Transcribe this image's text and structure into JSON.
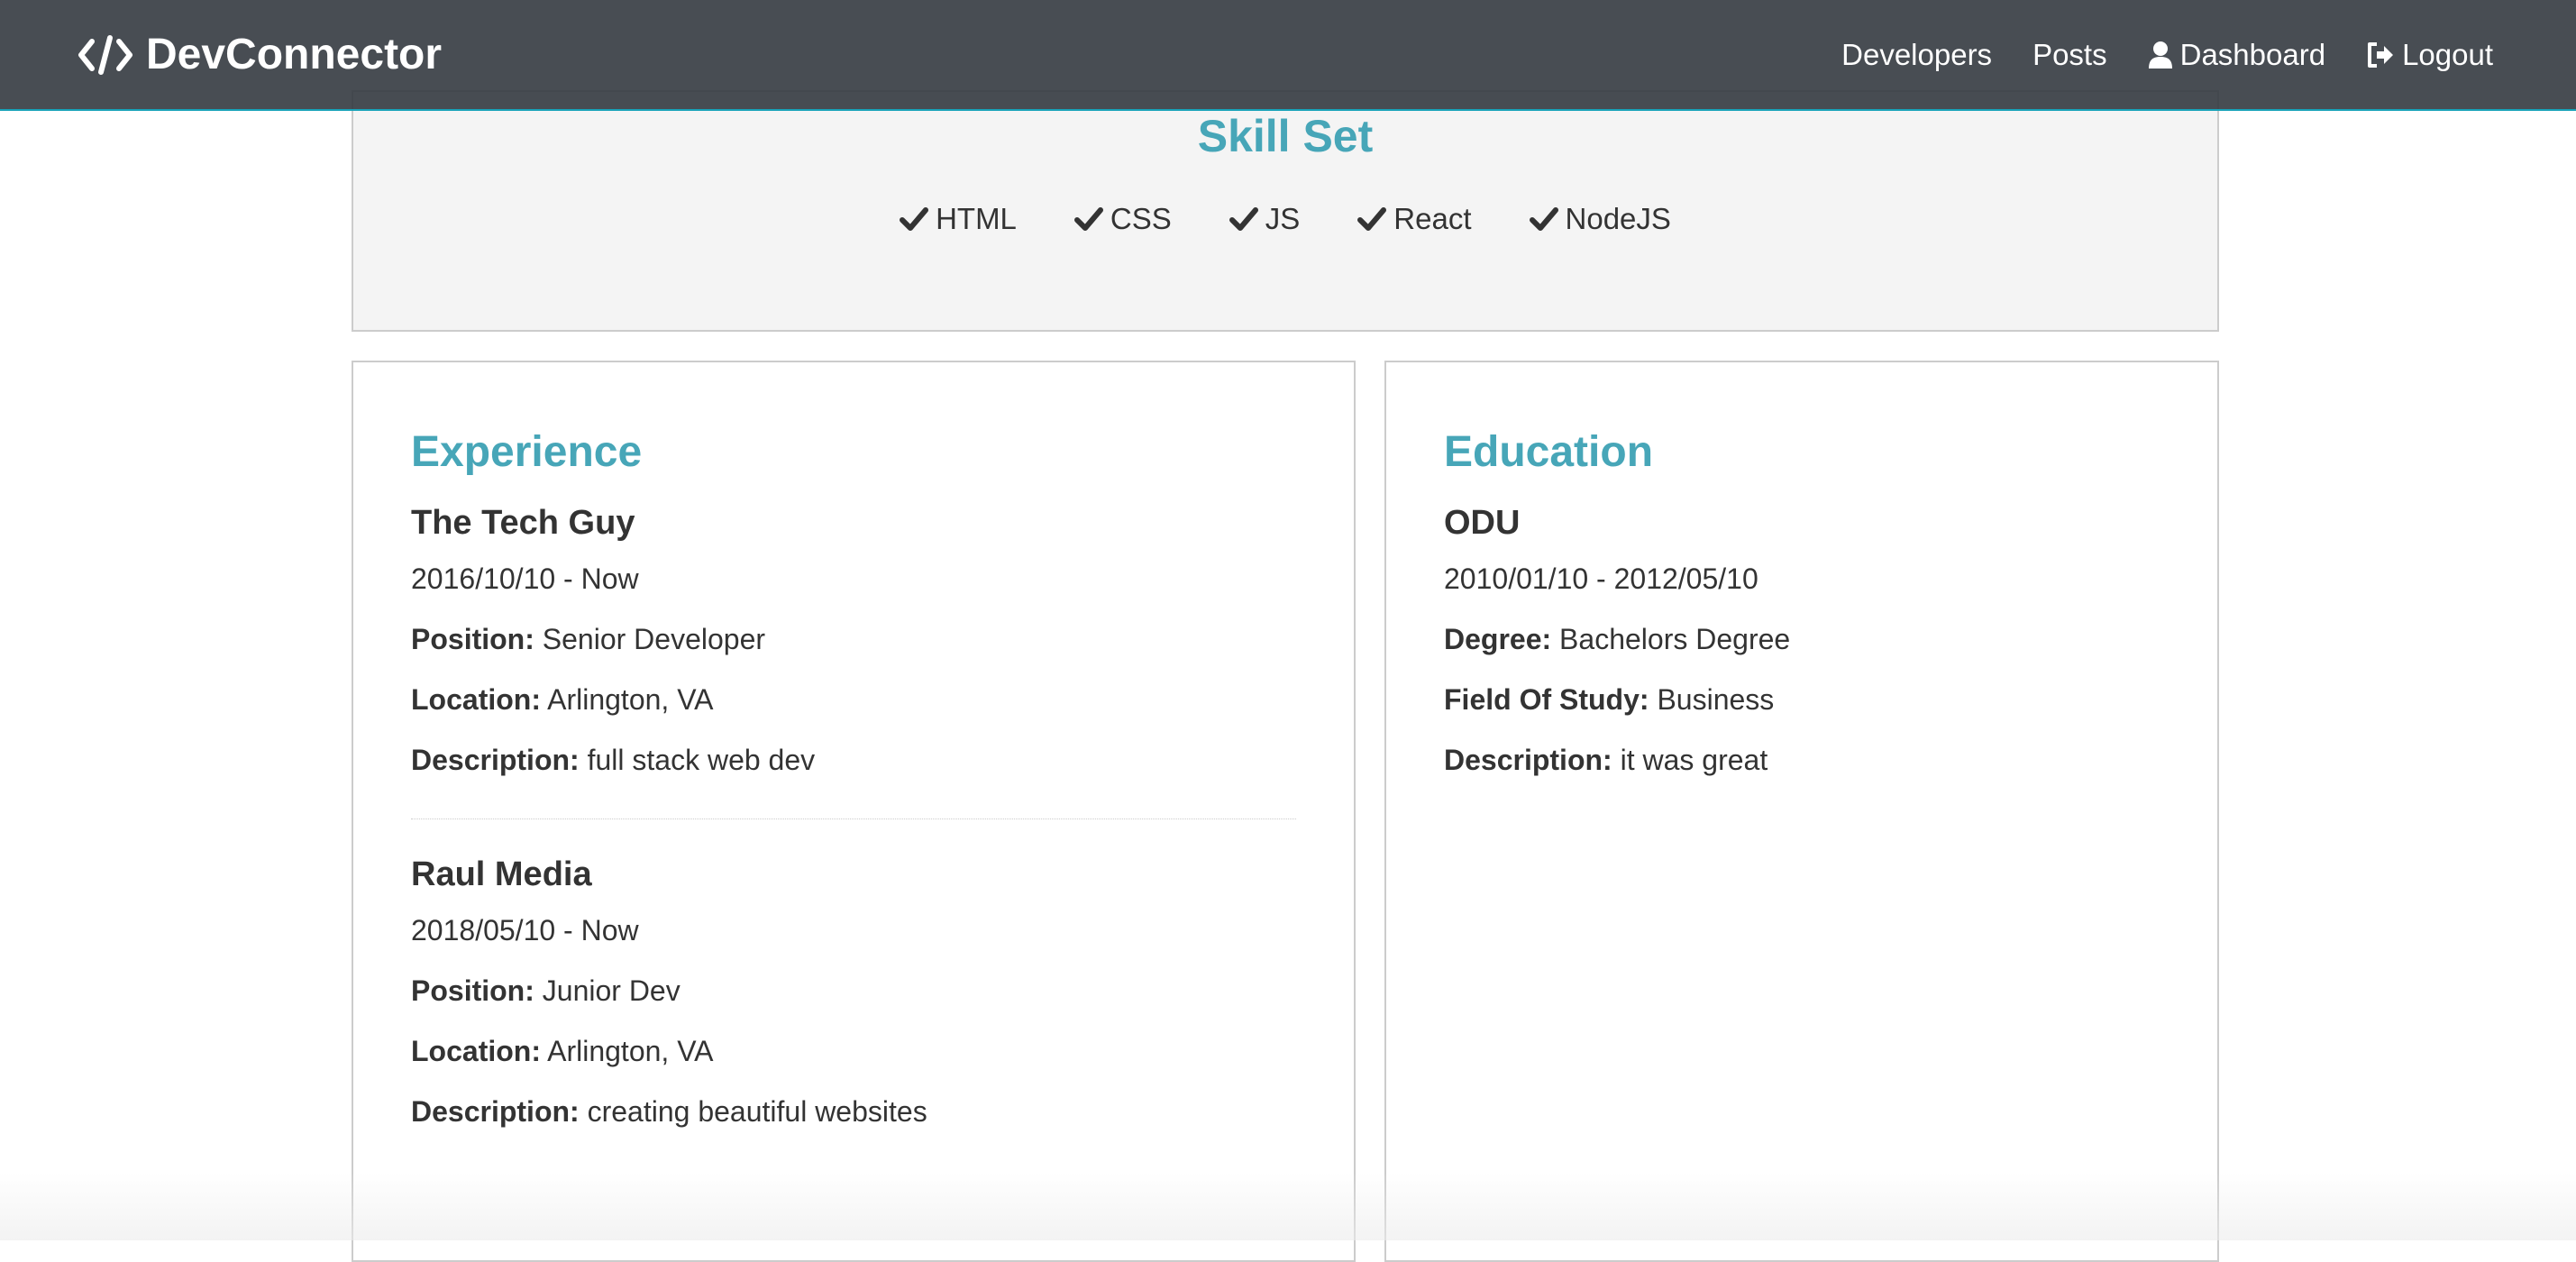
{
  "navbar": {
    "brand": "DevConnector",
    "links": [
      {
        "label": "Developers"
      },
      {
        "label": "Posts"
      },
      {
        "label": "Dashboard"
      },
      {
        "label": "Logout"
      }
    ]
  },
  "skills": {
    "title": "Skill Set",
    "items": [
      "HTML",
      "CSS",
      "JS",
      "React",
      "NodeJS"
    ]
  },
  "experience": {
    "title": "Experience",
    "entries": [
      {
        "company": "The Tech Guy",
        "dates": "2016/10/10 - Now",
        "position_label": "Position:",
        "position": "Senior Developer",
        "location_label": "Location:",
        "location": "Arlington, VA",
        "description_label": "Description:",
        "description": "full stack web dev"
      },
      {
        "company": "Raul Media",
        "dates": "2018/05/10 - Now",
        "position_label": "Position:",
        "position": "Junior Dev",
        "location_label": "Location:",
        "location": "Arlington, VA",
        "description_label": "Description:",
        "description": "creating beautiful websites"
      }
    ]
  },
  "education": {
    "title": "Education",
    "entries": [
      {
        "school": "ODU",
        "dates": "2010/01/10 - 2012/05/10",
        "degree_label": "Degree:",
        "degree": "Bachelors Degree",
        "field_label": "Field Of Study:",
        "field": "Business",
        "description_label": "Description:",
        "description": "it was great"
      }
    ]
  },
  "colors": {
    "navbar": "#343a40",
    "accent": "#47a6b8",
    "panel": "#f4f4f4",
    "border": "#cccccc"
  },
  "icons": {
    "brand": "code-icon",
    "dashboard": "user-icon",
    "logout": "sign-out-icon",
    "skill": "check-icon"
  }
}
